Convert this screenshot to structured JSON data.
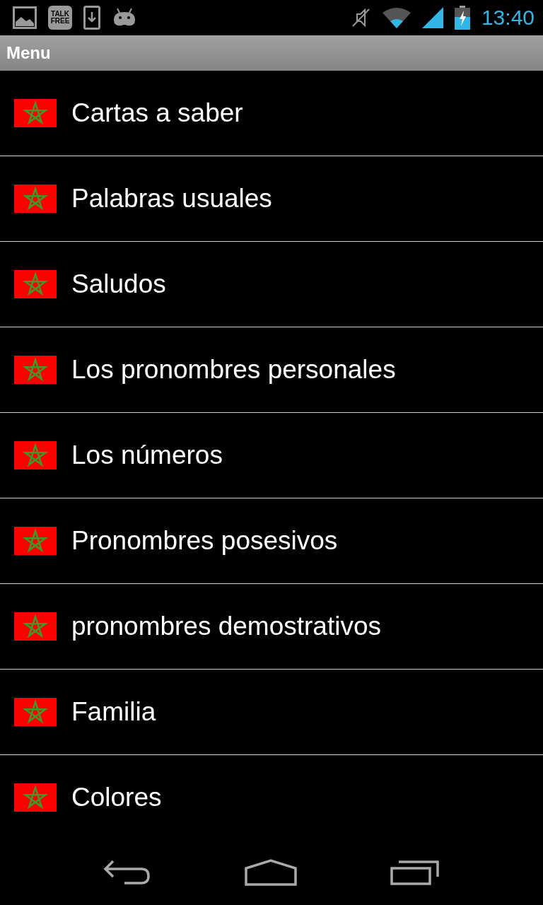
{
  "status_bar": {
    "notifications": [
      {
        "kind": "picture"
      },
      {
        "kind": "talk",
        "lines": [
          "TALK",
          "FREE"
        ]
      },
      {
        "kind": "download"
      },
      {
        "kind": "android"
      }
    ],
    "time": "13:40"
  },
  "title_bar": {
    "title": "Menu"
  },
  "menu_items": [
    {
      "label": "Cartas a saber"
    },
    {
      "label": "Palabras usuales"
    },
    {
      "label": "Saludos"
    },
    {
      "label": "Los pronombres personales"
    },
    {
      "label": "Los números"
    },
    {
      "label": "Pronombres posesivos"
    },
    {
      "label": "pronombres demostrativos"
    },
    {
      "label": "Familia"
    },
    {
      "label": "Colores"
    }
  ]
}
